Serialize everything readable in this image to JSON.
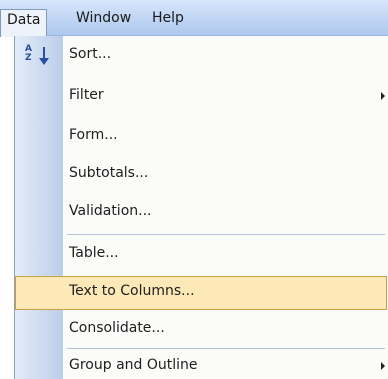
{
  "menubar": {
    "items": [
      {
        "label": "Data",
        "active": true
      },
      {
        "label": "Window",
        "active": false
      },
      {
        "label": "Help",
        "active": false
      }
    ]
  },
  "data_menu": {
    "items": [
      {
        "label": "Sort...",
        "icon": "sort-ascending-icon"
      },
      {
        "label": "Filter",
        "submenu": true
      },
      {
        "label": "Form..."
      },
      {
        "label": "Subtotals..."
      },
      {
        "label": "Validation..."
      },
      {
        "label": "Table..."
      },
      {
        "label": "Text to Columns...",
        "highlighted": true
      },
      {
        "label": "Consolidate..."
      },
      {
        "label": "Group and Outline",
        "submenu": true
      }
    ]
  },
  "colors": {
    "highlight_fill": "#fce9b7",
    "highlight_border": "#c9a142",
    "menubar": "#c3d8f5",
    "icon_column": "#cbdaf0"
  }
}
